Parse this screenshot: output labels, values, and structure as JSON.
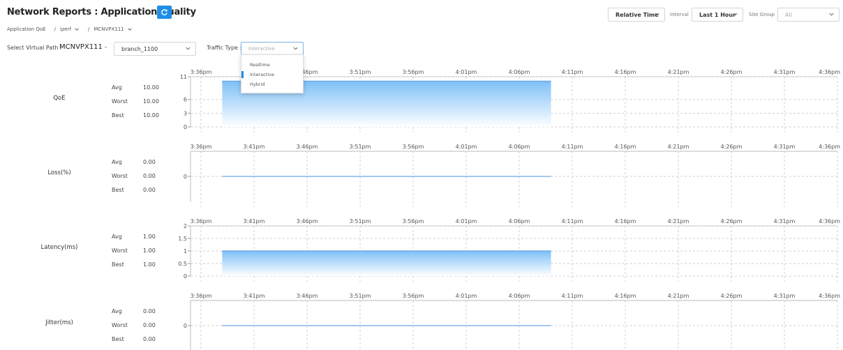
{
  "header": {
    "title": "Network Reports : Application Quality",
    "time_mode": "Relative Time",
    "interval_label": "Interval",
    "interval_value": "Last 1 Hour",
    "site_group_label": "Site Group",
    "site_group_value": "All"
  },
  "breadcrumb": [
    {
      "label": "Application QoE",
      "has_chevron": false
    },
    {
      "label": "iperf",
      "has_chevron": true
    },
    {
      "label": "MCNVPX111",
      "has_chevron": true
    }
  ],
  "filters": {
    "virtual_path_label": "Select Virtual Path :",
    "virtual_path_value": "MCNVPX111",
    "separator": "-",
    "branch_value": "branch_1100",
    "traffic_type_label": "Traffic Type :",
    "traffic_type_placeholder": "Interactive",
    "traffic_type_options": [
      "Realtime",
      "Interactive",
      "Hybrid"
    ],
    "traffic_type_highlighted": "Interactive"
  },
  "stat_labels": [
    "Avg",
    "Worst",
    "Best"
  ],
  "colors": {
    "accent": "#1f8ee6",
    "area_top": "#7ec0f7",
    "area_bottom": "#ffffff",
    "line": "#6aa8e8",
    "grid": "#cfcfcf"
  },
  "chart_data": [
    {
      "type": "area",
      "name": "QoE",
      "stats": {
        "avg": "10.00",
        "worst": "10.00",
        "best": "10.00"
      },
      "x_ticks": [
        "3:36pm",
        "3:41pm",
        "3:46pm",
        "3:51pm",
        "3:56pm",
        "4:01pm",
        "4:06pm",
        "4:11pm",
        "4:16pm",
        "4:21pm",
        "4:26pm",
        "4:31pm",
        "4:36pm"
      ],
      "y_ticks": [
        0,
        3,
        6,
        11
      ],
      "ylim": [
        0,
        11
      ],
      "x": [
        "3:38pm",
        "4:09pm"
      ],
      "values": [
        10,
        10
      ]
    },
    {
      "type": "line",
      "name": "Loss(%)",
      "stats": {
        "avg": "0.00",
        "worst": "0.00",
        "best": "0.00"
      },
      "x_ticks": [
        "3:36pm",
        "3:41pm",
        "3:46pm",
        "3:51pm",
        "3:56pm",
        "4:01pm",
        "4:06pm",
        "4:11pm",
        "4:16pm",
        "4:21pm",
        "4:26pm",
        "4:31pm",
        "4:36pm"
      ],
      "y_ticks": [
        0
      ],
      "ylim": [
        -1,
        1
      ],
      "x": [
        "3:38pm",
        "4:09pm"
      ],
      "values": [
        0,
        0
      ]
    },
    {
      "type": "area",
      "name": "Latency(ms)",
      "stats": {
        "avg": "1.00",
        "worst": "1.00",
        "best": "1.00"
      },
      "x_ticks": [
        "3:36pm",
        "3:41pm",
        "3:46pm",
        "3:51pm",
        "3:56pm",
        "4:01pm",
        "4:06pm",
        "4:11pm",
        "4:16pm",
        "4:21pm",
        "4:26pm",
        "4:31pm",
        "4:36pm"
      ],
      "y_ticks": [
        0,
        0.5,
        1,
        1.5,
        2
      ],
      "ylim": [
        0,
        2
      ],
      "x": [
        "3:38pm",
        "4:09pm"
      ],
      "values": [
        1,
        1
      ]
    },
    {
      "type": "line",
      "name": "Jitter(ms)",
      "stats": {
        "avg": "0.00",
        "worst": "0.00",
        "best": "0.00"
      },
      "x_ticks": [
        "3:36pm",
        "3:41pm",
        "3:46pm",
        "3:51pm",
        "3:56pm",
        "4:01pm",
        "4:06pm",
        "4:11pm",
        "4:16pm",
        "4:21pm",
        "4:26pm",
        "4:31pm",
        "4:36pm"
      ],
      "y_ticks": [
        0
      ],
      "ylim": [
        -1,
        1
      ],
      "x": [
        "3:38pm",
        "4:09pm"
      ],
      "values": [
        0,
        0
      ]
    }
  ]
}
